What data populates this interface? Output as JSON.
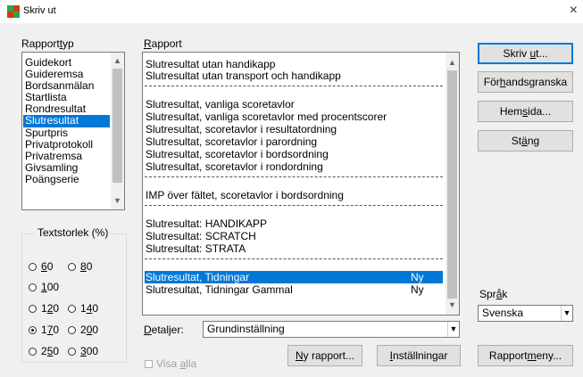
{
  "window": {
    "title": "Skriv ut",
    "close_glyph": "×"
  },
  "colors": {
    "selection": "#0078d7",
    "default_button_border": "#0078d7",
    "app_icon_green": "#2da44e",
    "app_icon_red": "#d83b01"
  },
  "rapporttyp": {
    "label_pre": "Rapport",
    "label_u": "t",
    "label_post": "yp",
    "items": [
      "Guidekort",
      "Guideremsa",
      "Bordsanmälan",
      "Startlista",
      "Rondresultat",
      "Slutresultat",
      "Spurtpris",
      "Privatprotokoll",
      "Privatremsa",
      "Givsamling",
      "Poängserie"
    ],
    "selected_index": 5
  },
  "rapport": {
    "label_u": "R",
    "label_post": "apport",
    "rows": [
      {
        "text": "Slutresultat utan handikapp",
        "tag": ""
      },
      {
        "text": "Slutresultat utan transport och handikapp",
        "tag": ""
      },
      {
        "text": "Slutresultat, vanliga scoretavlor",
        "tag": ""
      },
      {
        "text": "Slutresultat, vanliga scoretavlor med procentscorer",
        "tag": ""
      },
      {
        "text": "Slutresultat, scoretavlor i resultatordning",
        "tag": ""
      },
      {
        "text": "Slutresultat, scoretavlor i parordning",
        "tag": ""
      },
      {
        "text": "Slutresultat, scoretavlor i bordsordning",
        "tag": ""
      },
      {
        "text": "Slutresultat, scoretavlor i rondordning",
        "tag": ""
      },
      {
        "text": "IMP över fältet, scoretavlor i bordsordning",
        "tag": ""
      },
      {
        "text": "Slutresultat: HANDIKAPP",
        "tag": ""
      },
      {
        "text": "Slutresultat: SCRATCH",
        "tag": ""
      },
      {
        "text": "Slutresultat: STRATA",
        "tag": ""
      },
      {
        "text": "Slutresultat, Tidningar",
        "tag": "Ny"
      },
      {
        "text": "Slutresultat, Tidningar Gammal",
        "tag": "Ny"
      }
    ],
    "selected_index": 12
  },
  "detaljer": {
    "label_u": "D",
    "label_post": "etaljer:",
    "value": "Grundinställning"
  },
  "textstorlek": {
    "title": "Textstorlek (%)",
    "options": [
      {
        "u": "6",
        "rest": "0"
      },
      {
        "u": "8",
        "rest": "0"
      },
      {
        "u": "1",
        "rest": "00"
      },
      {
        "pre": "1",
        "u": "2",
        "rest": "0"
      },
      {
        "pre": "1",
        "u": "4",
        "rest": "0"
      },
      {
        "pre": "1",
        "u": "7",
        "rest": "0"
      },
      {
        "pre": "2",
        "u": "0",
        "rest": "0"
      },
      {
        "pre": "2",
        "u": "5",
        "rest": "0"
      },
      {
        "u": "3",
        "rest": "00"
      }
    ],
    "selected": 5
  },
  "visa_alla": {
    "label_pre": "Visa ",
    "label_u": "a",
    "label_post": "lla",
    "checked": false
  },
  "buttons": {
    "skriv_ut": {
      "pre": "Skriv ",
      "u": "u",
      "post": "t..."
    },
    "forhandsgranska": {
      "pre": "För",
      "u": "h",
      "post": "andsgranska"
    },
    "hemsida": {
      "pre": "Hem",
      "u": "s",
      "post": "ida..."
    },
    "stang": {
      "pre": "St",
      "u": "ä",
      "post": "ng"
    },
    "ny_rapport": {
      "pre": "",
      "u": "N",
      "post": "y rapport..."
    },
    "installningar": {
      "pre": "",
      "u": "I",
      "post": "nställningar"
    },
    "rapportmeny": {
      "pre": "Rapport",
      "u": "m",
      "post": "eny..."
    }
  },
  "sprak": {
    "label_pre": "Spr",
    "label_u": "å",
    "label_post": "k",
    "value": "Svenska"
  },
  "scroll_arrows": {
    "up": "▲",
    "down": "▼",
    "dropdown": "▼"
  }
}
